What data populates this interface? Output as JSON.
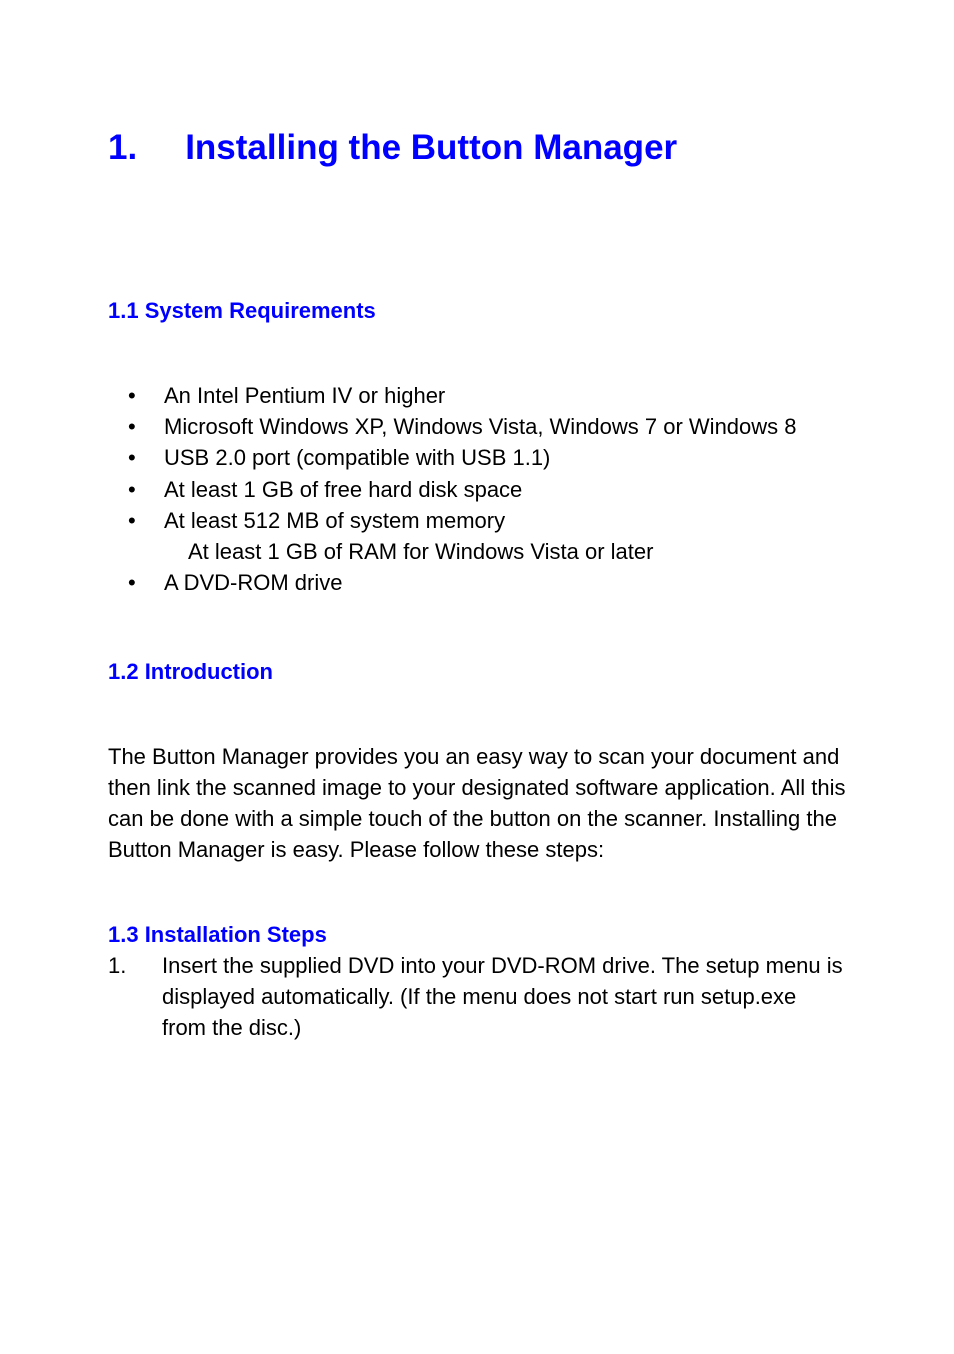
{
  "chapter": {
    "number": "1.",
    "title": "Installing the Button Manager"
  },
  "section1": {
    "heading": "1.1 System Requirements",
    "items": [
      "An Intel Pentium IV or higher",
      "Microsoft Windows XP, Windows Vista, Windows 7 or Windows 8",
      "USB 2.0 port (compatible with USB 1.1)",
      "At least 1 GB of free hard disk space",
      "At least 512 MB of system memory",
      "A DVD-ROM drive"
    ],
    "sub_note": "At least 1 GB of RAM for Windows Vista or later"
  },
  "section2": {
    "heading": "1.2 Introduction",
    "paragraph": "The Button Manager provides you an easy way to scan your document and then link the scanned image to your designated software application.   All this can be done with a simple touch of the button on the scanner.   Installing the Button Manager is easy.   Please follow these steps:"
  },
  "section3": {
    "heading": "1.3 Installation Steps",
    "step1_num": "1.",
    "step1_text": "Insert the supplied DVD into your DVD-ROM drive. The setup menu is displayed automatically. (If the menu does not start run setup.exe from the disc.)"
  }
}
